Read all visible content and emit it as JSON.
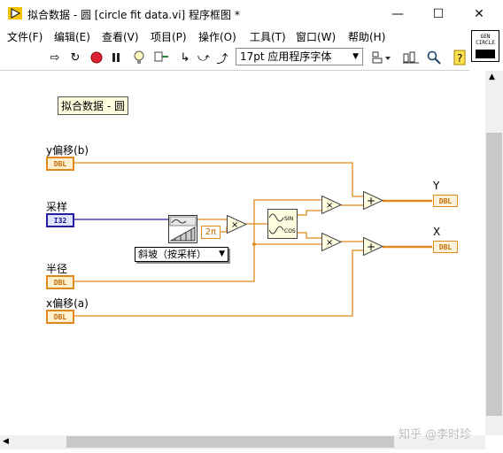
{
  "window": {
    "title": "拟合数据 - 圆 [circle fit data.vi] 程序框图 *",
    "controls": {
      "minimize": "—",
      "maximize": "☐",
      "close": "✕"
    }
  },
  "menu": [
    "文件(F)",
    "编辑(E)",
    "查看(V)",
    "项目(P)",
    "操作(O)",
    "工具(T)",
    "窗口(W)",
    "帮助(H)"
  ],
  "toolbar": {
    "font": "17pt 应用程序字体",
    "icons": [
      "run-arrow",
      "run-continuously",
      "abort",
      "pause",
      "highlight-execution",
      "retain-wire-values",
      "step-into",
      "step-over",
      "step-out",
      "align",
      "distribute",
      "reorder",
      "search",
      "context-help"
    ]
  },
  "vi_icon": {
    "line1": "GEN",
    "line2": "CIRCLE"
  },
  "diagram": {
    "free_label": "拟合数据 - 圆",
    "controls": {
      "y_offset": {
        "label": "y偏移(b)",
        "type": "DBL"
      },
      "samples": {
        "label": "采样",
        "type": "I32"
      },
      "radius": {
        "label": "半径",
        "type": "DBL"
      },
      "x_offset": {
        "label": "x偏移(a)",
        "type": "DBL"
      }
    },
    "indicators": {
      "y": {
        "label": "Y",
        "type": "DBL"
      },
      "x": {
        "label": "X",
        "type": "DBL"
      }
    },
    "constant_2pi": "2π",
    "ramp_mode": "斜坡（按采样）",
    "sincos": {
      "top": "SIN",
      "bottom": "COS"
    },
    "operators": {
      "multiply": "×",
      "add": "+"
    },
    "wire_colors": {
      "double": "#e2891d",
      "integer": "#2020a0"
    }
  },
  "watermark": "知乎 @李时珍"
}
